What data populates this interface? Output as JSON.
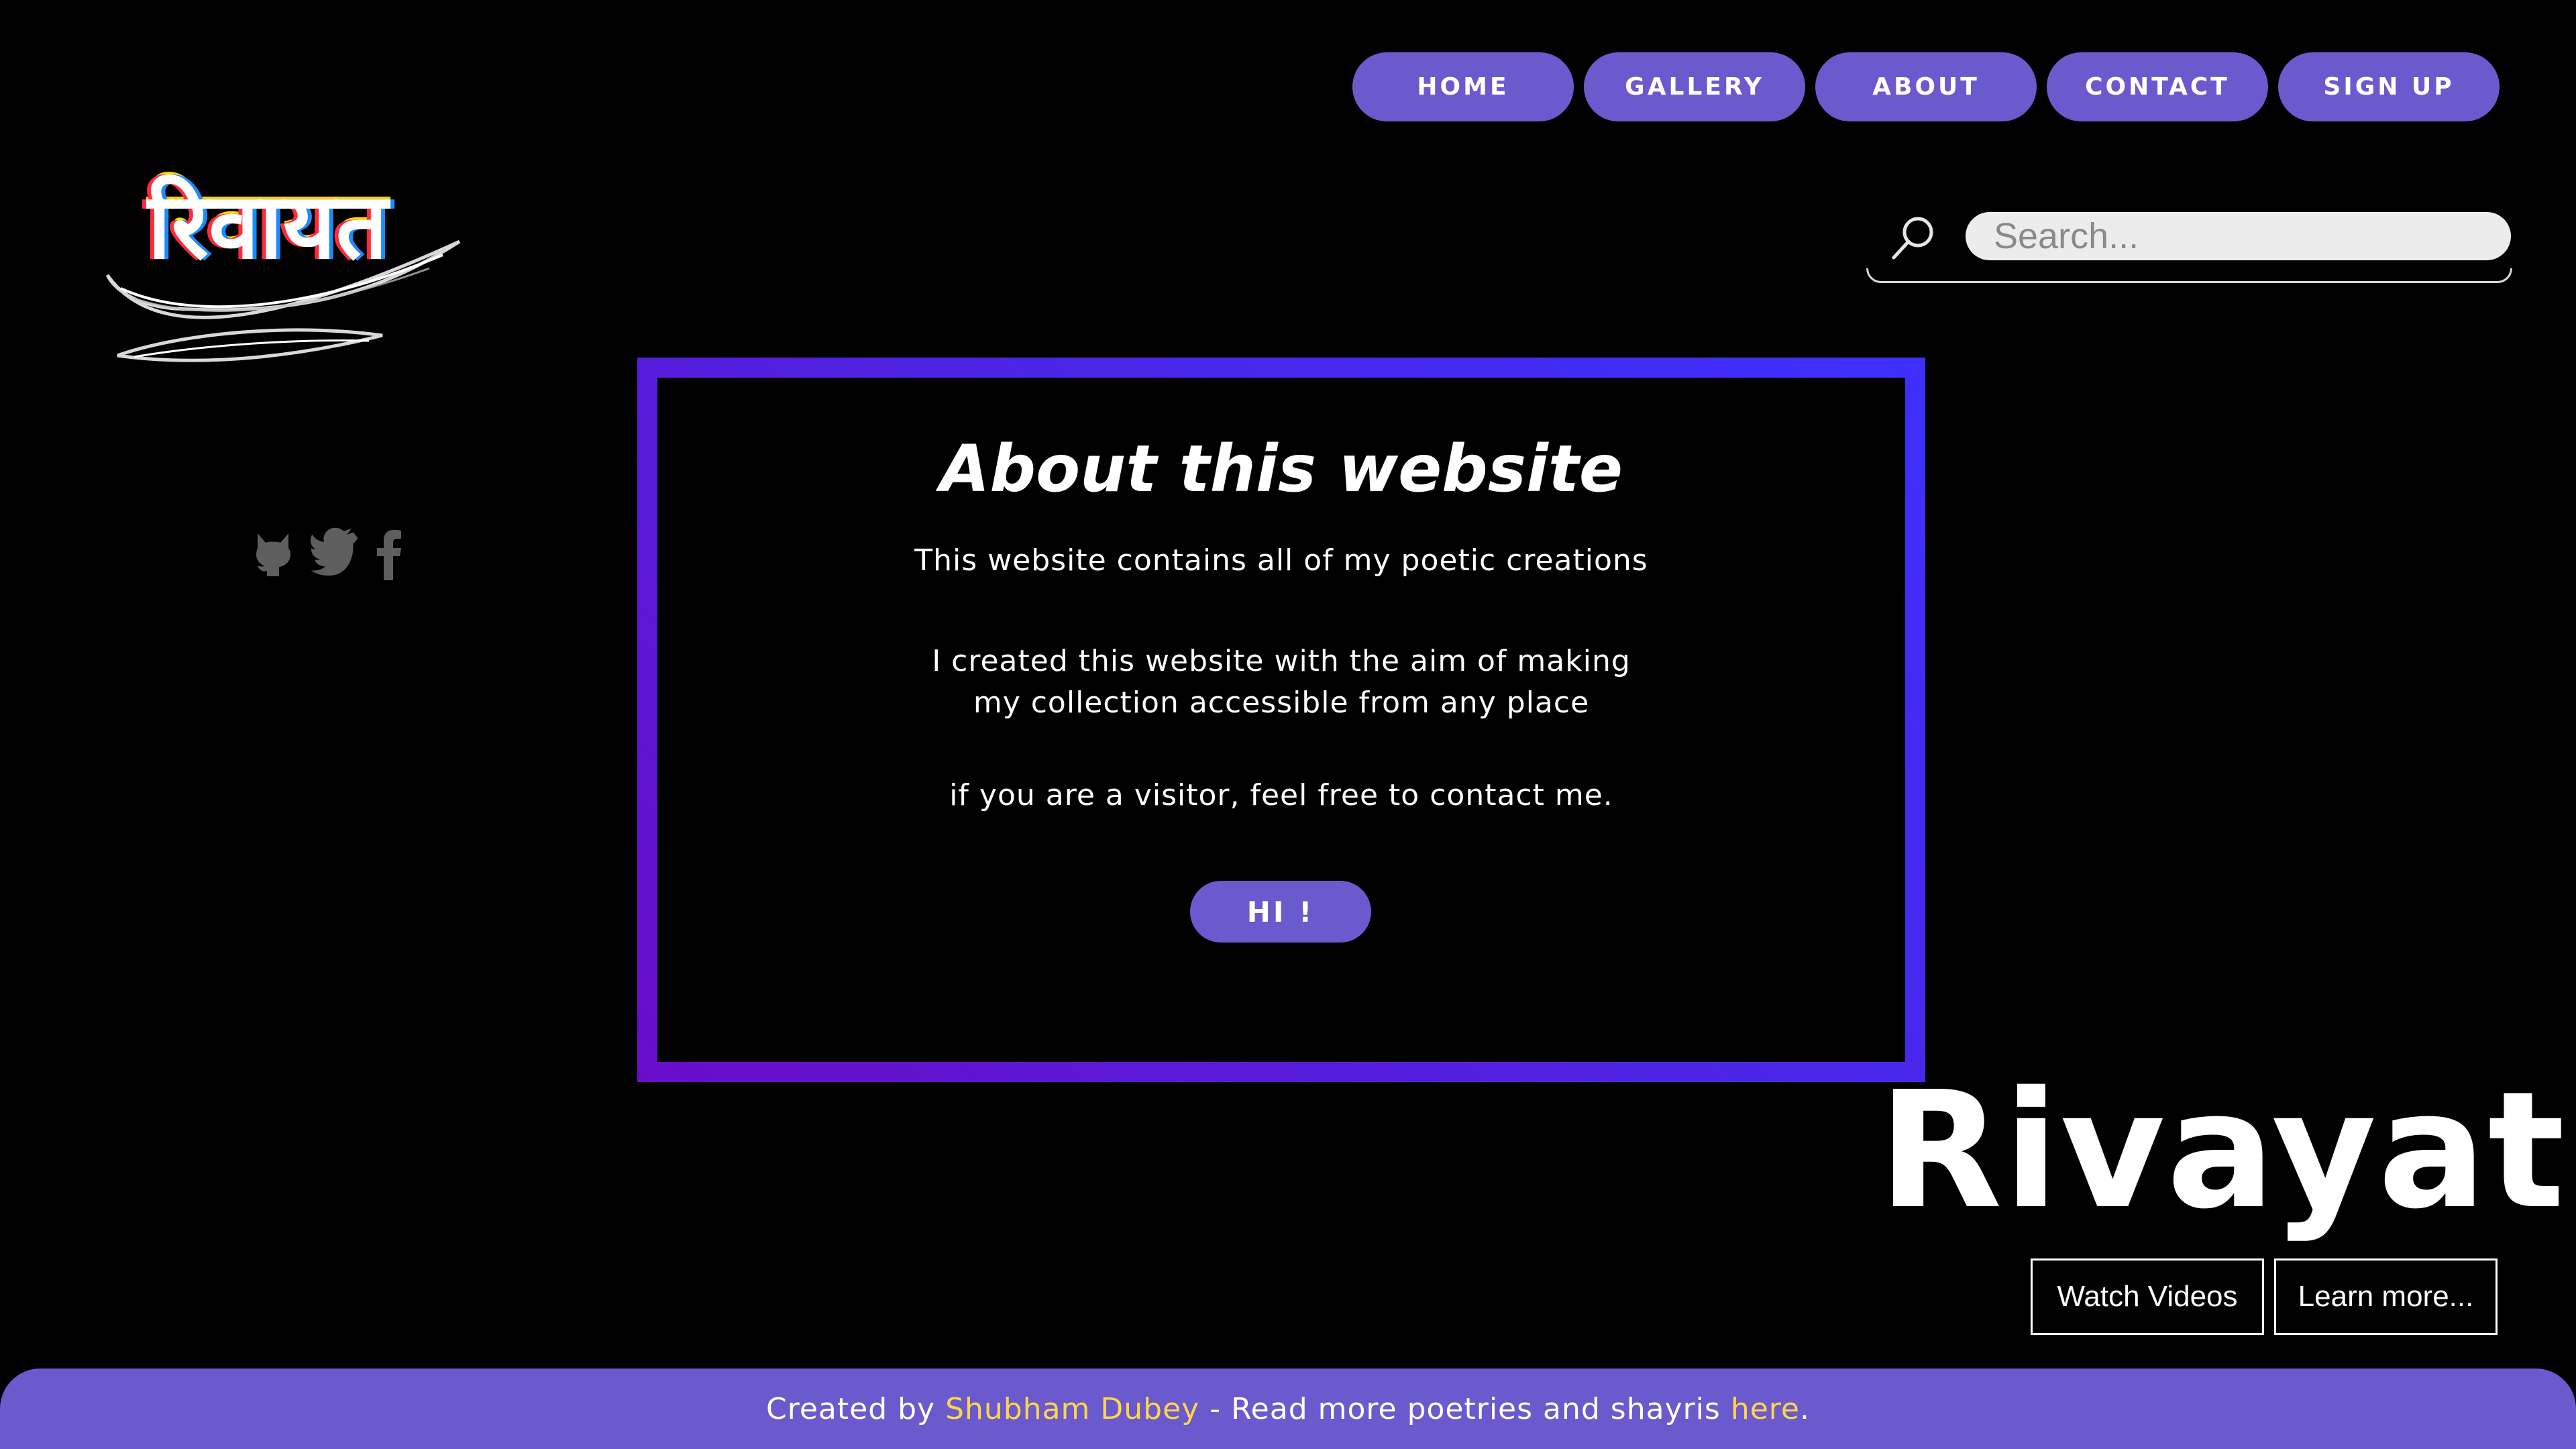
{
  "nav": {
    "items": [
      "HOME",
      "GALLERY",
      "ABOUT",
      "CONTACT",
      "SIGN UP"
    ]
  },
  "logo": {
    "text": "रिवायत"
  },
  "social": {
    "icons": [
      "github-icon",
      "twitter-icon",
      "facebook-icon"
    ]
  },
  "search": {
    "placeholder": "Search..."
  },
  "about": {
    "title": "About this website",
    "paragraph1": "This website contains all of my poetic creations",
    "paragraph2": "I created this website with the aim of making my collection accessible from any place",
    "paragraph3": "if you are a visitor, feel free to contact me.",
    "button_label": "HI !"
  },
  "brand": {
    "name": "Rivayat",
    "watch_videos": "Watch Videos",
    "learn_more": "Learn more..."
  },
  "footer": {
    "prefix": "Created by ",
    "author": "Shubham Dubey",
    "middle": " - Read more poetries and shayris ",
    "link": "here",
    "suffix": "."
  },
  "colors": {
    "accent": "#6a5acd",
    "border_gradient_start": "#6a0dc9",
    "border_gradient_end": "#3e2fff",
    "highlight": "#ffd54a"
  }
}
